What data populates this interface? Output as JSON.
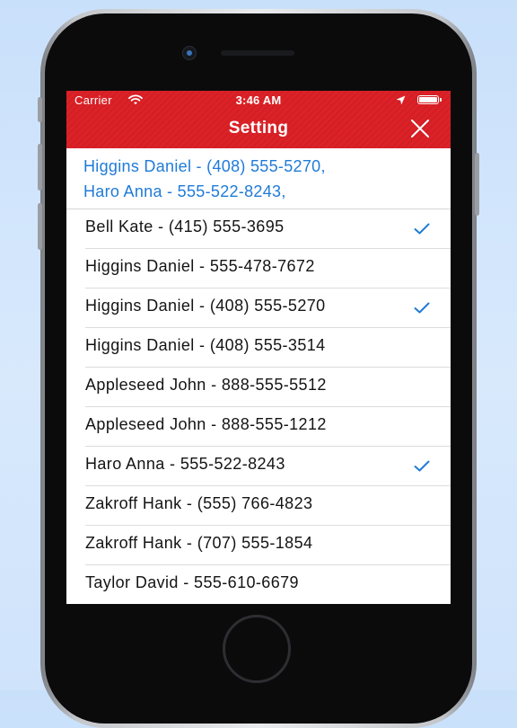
{
  "status_bar": {
    "carrier": "Carrier",
    "time": "3:46 AM",
    "icons": [
      "wifi-icon",
      "location-icon",
      "battery-icon"
    ]
  },
  "nav": {
    "title": "Setting",
    "close_icon": "close-icon"
  },
  "selected": {
    "lines": [
      "Higgins Daniel - (408) 555-5270,",
      "Haro Anna - 555-522-8243,"
    ]
  },
  "contacts": [
    {
      "label": "Bell Kate - (415) 555-3695",
      "checked": true
    },
    {
      "label": "Higgins Daniel - 555-478-7672",
      "checked": false
    },
    {
      "label": "Higgins Daniel - (408) 555-5270",
      "checked": true
    },
    {
      "label": "Higgins Daniel - (408) 555-3514",
      "checked": false
    },
    {
      "label": "Appleseed John - 888-555-5512",
      "checked": false
    },
    {
      "label": "Appleseed John - 888-555-1212",
      "checked": false
    },
    {
      "label": "Haro Anna - 555-522-8243",
      "checked": true
    },
    {
      "label": "Zakroff Hank - (555) 766-4823",
      "checked": false
    },
    {
      "label": "Zakroff Hank - (707) 555-1854",
      "checked": false
    },
    {
      "label": "Taylor David - 555-610-6679",
      "checked": false
    }
  ],
  "colors": {
    "header_red": "#dc2127",
    "accent_blue": "#1f7bd8",
    "background_blue": "#cfe3fb"
  }
}
